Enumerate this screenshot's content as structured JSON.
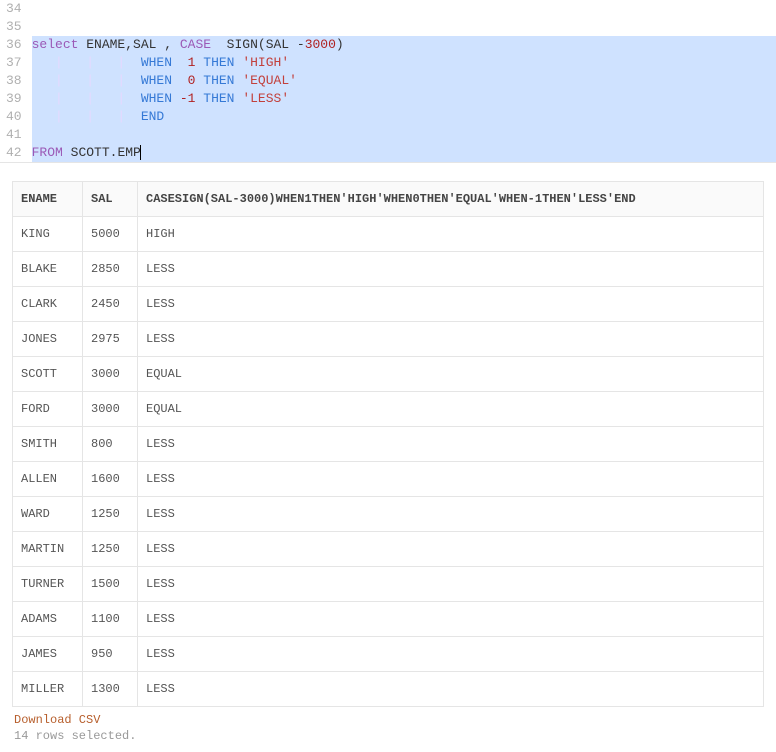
{
  "editor": {
    "line_numbers": [
      "34",
      "35",
      "36",
      "37",
      "38",
      "39",
      "40",
      "41",
      "42"
    ],
    "lines": {
      "l36": {
        "select": "select",
        "cols": " ENAME,SAL , ",
        "case": "CASE",
        "sp": "  ",
        "func": "SIGN",
        "op": "(SAL -",
        "num": "3000",
        "cp": ")"
      },
      "l37": {
        "pad": "              ",
        "when": "WHEN",
        "sp1": "  ",
        "num": "1",
        "sp2": " ",
        "then": "THEN",
        "sp3": " ",
        "str": "'HIGH'"
      },
      "l38": {
        "pad": "              ",
        "when": "WHEN",
        "sp1": "  ",
        "num": "0",
        "sp2": " ",
        "then": "THEN",
        "sp3": " ",
        "str": "'EQUAL'"
      },
      "l39": {
        "pad": "              ",
        "when": "WHEN",
        "sp1": " ",
        "num": "-1",
        "sp2": " ",
        "then": "THEN",
        "sp3": " ",
        "str": "'LESS'"
      },
      "l40": {
        "pad": "              ",
        "end": "END"
      },
      "l42": {
        "from": "FROM",
        "sp": " ",
        "tbl": "SCOTT.EMP"
      }
    }
  },
  "results": {
    "columns": [
      "ENAME",
      "SAL",
      "CASESIGN(SAL-3000)WHEN1THEN'HIGH'WHEN0THEN'EQUAL'WHEN-1THEN'LESS'END"
    ],
    "rows": [
      {
        "ename": "KING",
        "sal": "5000",
        "val": "HIGH"
      },
      {
        "ename": "BLAKE",
        "sal": "2850",
        "val": "LESS"
      },
      {
        "ename": "CLARK",
        "sal": "2450",
        "val": "LESS"
      },
      {
        "ename": "JONES",
        "sal": "2975",
        "val": "LESS"
      },
      {
        "ename": "SCOTT",
        "sal": "3000",
        "val": "EQUAL"
      },
      {
        "ename": "FORD",
        "sal": "3000",
        "val": "EQUAL"
      },
      {
        "ename": "SMITH",
        "sal": "800",
        "val": "LESS"
      },
      {
        "ename": "ALLEN",
        "sal": "1600",
        "val": "LESS"
      },
      {
        "ename": "WARD",
        "sal": "1250",
        "val": "LESS"
      },
      {
        "ename": "MARTIN",
        "sal": "1250",
        "val": "LESS"
      },
      {
        "ename": "TURNER",
        "sal": "1500",
        "val": "LESS"
      },
      {
        "ename": "ADAMS",
        "sal": "1100",
        "val": "LESS"
      },
      {
        "ename": "JAMES",
        "sal": "950",
        "val": "LESS"
      },
      {
        "ename": "MILLER",
        "sal": "1300",
        "val": "LESS"
      }
    ],
    "download_label": "Download CSV",
    "status": "14 rows selected."
  },
  "chart_data": {
    "type": "table",
    "title": "",
    "columns": [
      "ENAME",
      "SAL",
      "CASESIGN(SAL-3000)WHEN1THEN'HIGH'WHEN0THEN'EQUAL'WHEN-1THEN'LESS'END"
    ],
    "rows": [
      [
        "KING",
        5000,
        "HIGH"
      ],
      [
        "BLAKE",
        2850,
        "LESS"
      ],
      [
        "CLARK",
        2450,
        "LESS"
      ],
      [
        "JONES",
        2975,
        "LESS"
      ],
      [
        "SCOTT",
        3000,
        "EQUAL"
      ],
      [
        "FORD",
        3000,
        "EQUAL"
      ],
      [
        "SMITH",
        800,
        "LESS"
      ],
      [
        "ALLEN",
        1600,
        "LESS"
      ],
      [
        "WARD",
        1250,
        "LESS"
      ],
      [
        "MARTIN",
        1250,
        "LESS"
      ],
      [
        "TURNER",
        1500,
        "LESS"
      ],
      [
        "ADAMS",
        1100,
        "LESS"
      ],
      [
        "JAMES",
        950,
        "LESS"
      ],
      [
        "MILLER",
        1300,
        "LESS"
      ]
    ]
  }
}
